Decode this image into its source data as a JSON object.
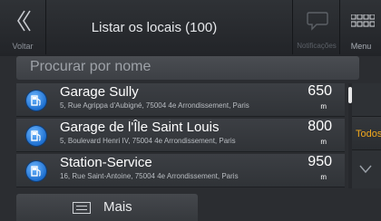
{
  "header": {
    "title": "Listar os locais (100)",
    "back_label": "Voltar",
    "notifications_label": "Notificações",
    "menu_label": "Menu",
    "back_icon": "chevron-left-icon",
    "notifications_icon": "speech-bubble-icon",
    "menu_icon": "grid-menu-icon"
  },
  "search": {
    "placeholder": "Procurar por nome"
  },
  "places": [
    {
      "name": "Garage Sully",
      "address": "5, Rue Agrippa d'Aubigné, 75004 4e Arrondissement, Paris",
      "distance": "650",
      "unit": "m"
    },
    {
      "name": "Garage de l'Île Saint Louis",
      "address": "5, Boulevard Henri IV, 75004 4e Arrondissement, Paris",
      "distance": "800",
      "unit": "m"
    },
    {
      "name": "Station-Service",
      "address": "16, Rue Saint-Antoine, 75004 4e Arrondissement, Paris",
      "distance": "950",
      "unit": "m"
    }
  ],
  "side": {
    "all_label": "Todos"
  },
  "footer": {
    "more_label": "Mais"
  },
  "colors": {
    "accent": "#f2a81d",
    "place_icon": "#1d6fd0",
    "background": "#2b2d31"
  }
}
